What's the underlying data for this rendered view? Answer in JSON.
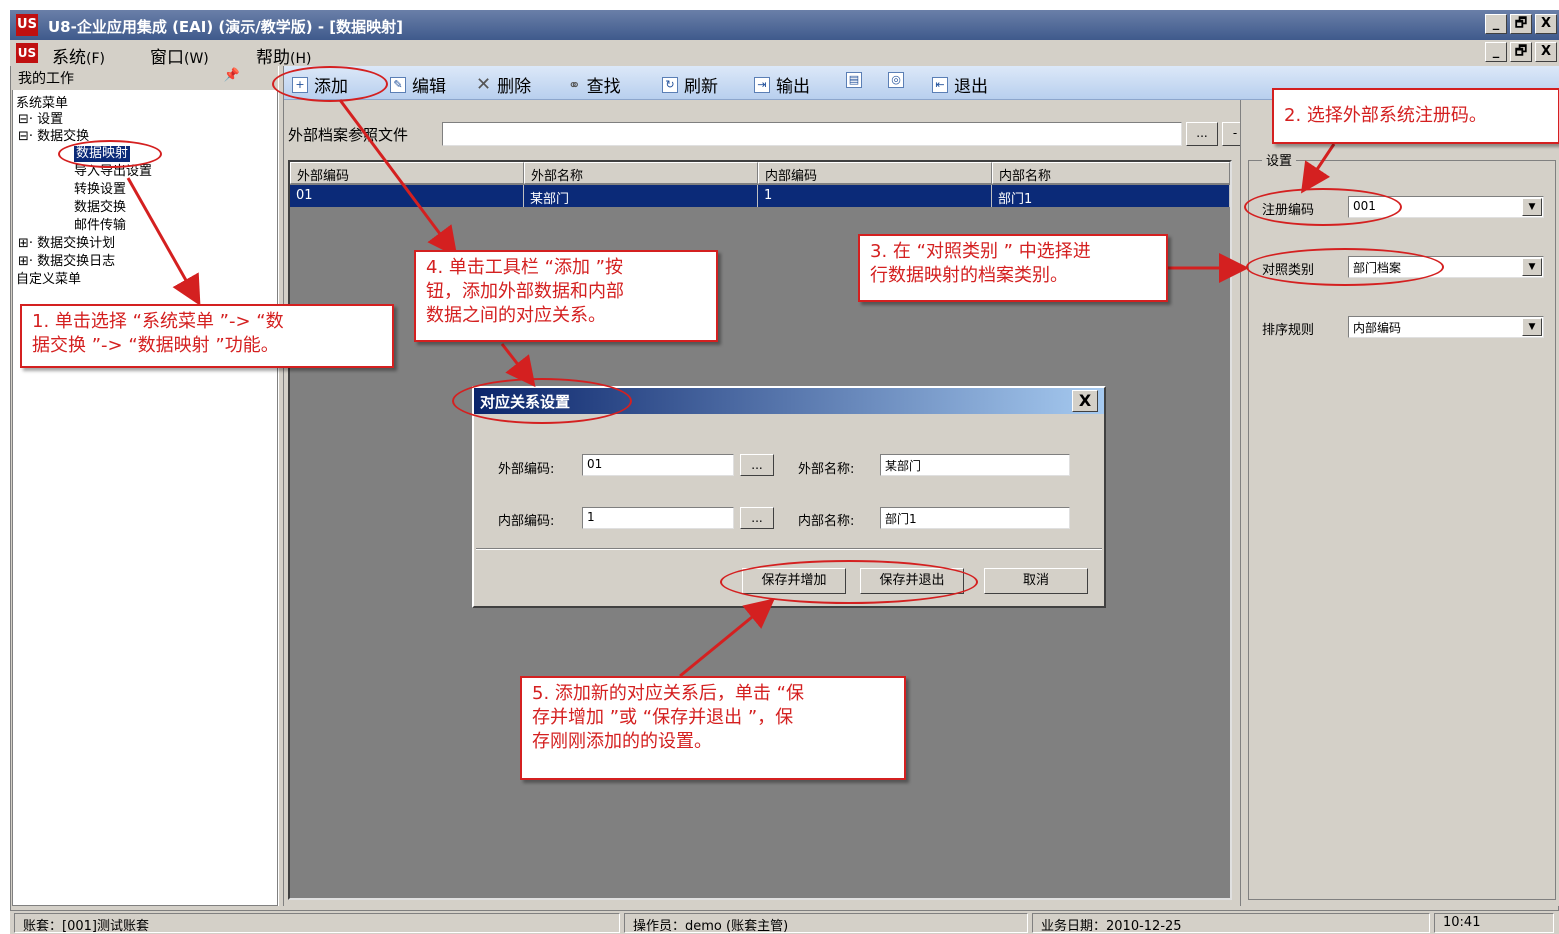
{
  "window": {
    "title": "U8-企业应用集成 (EAI) (演示/教学版) - [数据映射]",
    "logo": "US",
    "sys_buttons": [
      "_",
      "🗗",
      "X"
    ]
  },
  "menubar": {
    "logo": "US",
    "items": [
      {
        "label": "系统",
        "accel": "(F)"
      },
      {
        "label": "窗口",
        "accel": "(W)"
      },
      {
        "label": "帮助",
        "accel": "(H)"
      }
    ],
    "mdi_buttons": [
      "_",
      "🗗",
      "X"
    ]
  },
  "left": {
    "header": "我的工作",
    "pin_icon": "pin-icon",
    "tree": [
      "系统菜单",
      "⊟· 设置",
      "⊟· 数据交换",
      "数据映射",
      "导入导出设置",
      "转换设置",
      "数据交换",
      "邮件传输",
      "⊞· 数据交换计划",
      "⊞· 数据交换日志",
      "自定义菜单"
    ]
  },
  "toolbar": {
    "add": "添加",
    "edit": "编辑",
    "delete": "删除",
    "find": "查找",
    "refresh": "刷新",
    "export": "输出",
    "exit": "退出"
  },
  "file": {
    "label": "外部档案参照文件",
    "value": "",
    "browse": "...",
    "clear": "-"
  },
  "grid": {
    "headers": [
      "外部编码",
      "外部名称",
      "内部编码",
      "内部名称"
    ],
    "rows": [
      [
        "01",
        "某部门",
        "1",
        "部门1"
      ]
    ]
  },
  "settings": {
    "title": "设置",
    "reg_code_label": "注册编码",
    "reg_code_value": "001",
    "ref_type_label": "对照类别",
    "ref_type_value": "部门档案",
    "sort_label": "排序规则",
    "sort_value": "内部编码"
  },
  "dialog": {
    "title": "对应关系设置",
    "close": "X",
    "ext_code_label": "外部编码:",
    "ext_code_value": "01",
    "ext_name_label": "外部名称:",
    "ext_name_value": "某部门",
    "int_code_label": "内部编码:",
    "int_code_value": "1",
    "int_name_label": "内部名称:",
    "int_name_value": "部门1",
    "browse": "...",
    "save_add": "保存并增加",
    "save_exit": "保存并退出",
    "cancel": "取消"
  },
  "status": {
    "account": "账套：[001]测试账套",
    "operator": "操作员：demo (账套主管)",
    "biz_date": "业务日期：2010-12-25",
    "time": "10:41"
  },
  "notes": {
    "n1": "1. 单击选择 “系统菜单 ”-> “数\n据交换 ”-> “数据映射 ”功能。",
    "n2": "2. 选择外部系统注册码。",
    "n3": "3. 在 “对照类别 ” 中选择进\n行数据映射的档案类别。",
    "n4": "4. 单击工具栏 “添加 ”按\n钮，添加外部数据和内部\n数据之间的对应关系。",
    "n5": "5. 添加新的对应关系后，单击 “保\n存并增加 ”或 “保存并退出 ”，保\n存刚刚添加的的设置。"
  },
  "colors": {
    "annotation": "#d42020",
    "selection": "#0b2a78",
    "window_bg": "#d4d0c8",
    "grid_bg": "#808080"
  }
}
